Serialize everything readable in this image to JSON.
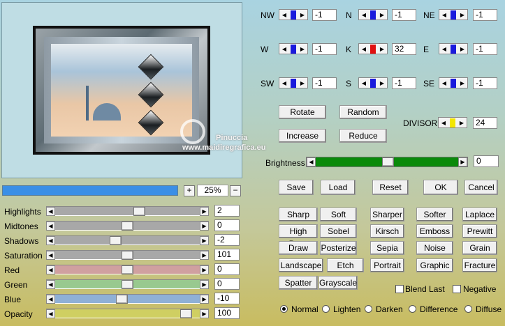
{
  "preview": {
    "watermark_name": "Pinuccia",
    "watermark_url": "www.maidiregrafica.eu"
  },
  "progress": {
    "fraction": 1.0
  },
  "zoom": {
    "plus_label": "+",
    "minus_label": "−",
    "value": "25%"
  },
  "sliders": [
    {
      "label": "Highlights",
      "value": "2",
      "pos": 0.59,
      "color": "#a8a8a8"
    },
    {
      "label": "Midtones",
      "value": "0",
      "pos": 0.5,
      "color": "#a8a8a8"
    },
    {
      "label": "Shadows",
      "value": "-2",
      "pos": 0.41,
      "color": "#a8a8a8"
    },
    {
      "label": "Saturation",
      "value": "101",
      "pos": 0.5,
      "color": "#a8a8a8"
    },
    {
      "label": "Red",
      "value": "0",
      "pos": 0.5,
      "color": "#d0a0a0"
    },
    {
      "label": "Green",
      "value": "0",
      "pos": 0.5,
      "color": "#98c98f"
    },
    {
      "label": "Blue",
      "value": "-10",
      "pos": 0.46,
      "color": "#8fb0d6"
    },
    {
      "label": "Opacity",
      "value": "100",
      "pos": 0.94,
      "color": "#cfcf62"
    }
  ],
  "matrix": [
    {
      "label": "NW",
      "value": "-1",
      "color": "#1a1adc"
    },
    {
      "label": "N",
      "value": "-1",
      "color": "#1a1adc"
    },
    {
      "label": "NE",
      "value": "-1",
      "color": "#1a1adc"
    },
    {
      "label": "W",
      "value": "-1",
      "color": "#1a1adc"
    },
    {
      "label": "K",
      "value": "32",
      "color": "#e01010"
    },
    {
      "label": "E",
      "value": "-1",
      "color": "#1a1adc"
    },
    {
      "label": "SW",
      "value": "-1",
      "color": "#1a1adc"
    },
    {
      "label": "S",
      "value": "-1",
      "color": "#1a1adc"
    },
    {
      "label": "SE",
      "value": "-1",
      "color": "#1a1adc"
    }
  ],
  "buttons": {
    "rotate": "Rotate",
    "random": "Random",
    "increase": "Increase",
    "reduce": "Reduce",
    "save": "Save",
    "load": "Load",
    "reset": "Reset",
    "ok": "OK",
    "cancel": "Cancel"
  },
  "divisor": {
    "label": "DIVISOR",
    "value": "24",
    "color": "#f4e600"
  },
  "brightness": {
    "label": "Brightness",
    "value": "0",
    "pos": 0.5,
    "color": "#0a8a0a"
  },
  "presets": [
    [
      "Sharp",
      "Soft",
      "Sharper",
      "Softer",
      "Laplace"
    ],
    [
      "High Pass",
      "Sobel",
      "Kirsch",
      "Emboss",
      "Prewitt"
    ],
    [
      "Draw",
      "Posterize",
      "Sepia",
      "Noise",
      "Grain"
    ],
    [
      "Landscape",
      "Etch",
      "Portrait",
      "Graphic",
      "Fracture"
    ],
    [
      "Spatter",
      "Grayscale"
    ]
  ],
  "checks": {
    "blend_last": "Blend Last",
    "negative": "Negative"
  },
  "blend_modes": [
    "Normal",
    "Lighten",
    "Darken",
    "Difference",
    "Diffuse"
  ],
  "blend_selected": "Normal"
}
